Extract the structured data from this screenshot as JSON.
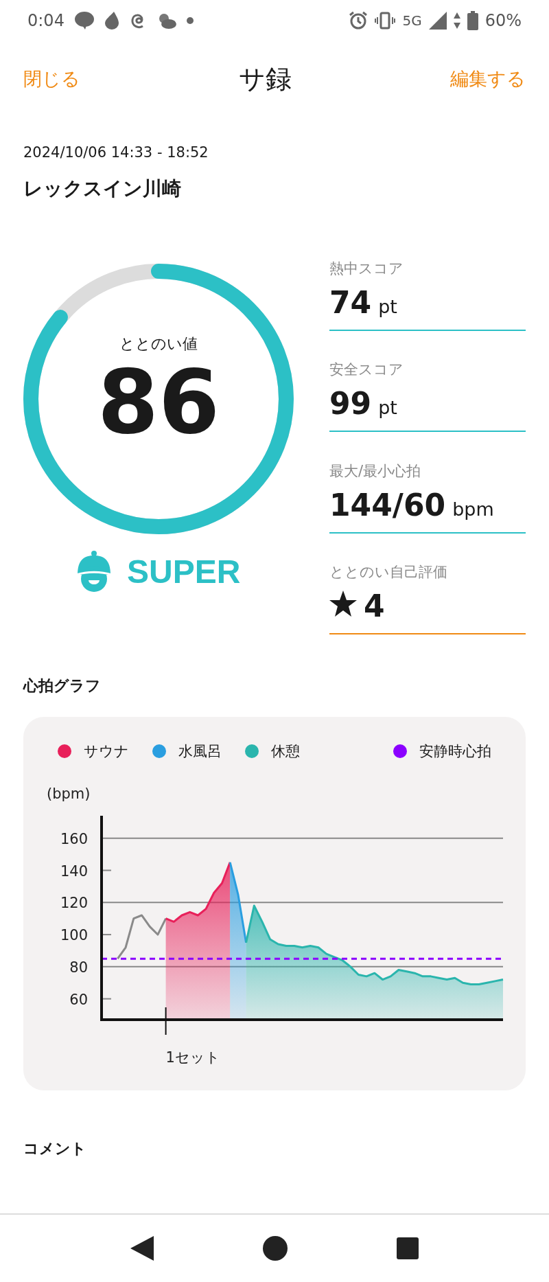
{
  "status_bar": {
    "time": "0:04",
    "network": "5G",
    "battery": "60%"
  },
  "header": {
    "close": "閉じる",
    "title": "サ録",
    "edit": "編集する"
  },
  "session": {
    "datetime": "2024/10/06 14:33 - 18:52",
    "venue": "レックスイン川崎"
  },
  "gauge": {
    "label": "ととのい値",
    "value": "86",
    "rank": "SUPER"
  },
  "stats": [
    {
      "kind": "score",
      "label": "熱中スコア",
      "value": "74",
      "unit": "pt"
    },
    {
      "kind": "score",
      "label": "安全スコア",
      "value": "99",
      "unit": "pt"
    },
    {
      "kind": "score",
      "label": "最大/最小心拍",
      "value": "144/60",
      "unit": "bpm"
    },
    {
      "kind": "rating",
      "label": "ととのい自己評価",
      "value": "4"
    }
  ],
  "heart_rate": {
    "title": "心拍グラフ",
    "chart_data": {
      "type": "line",
      "ylabel": "(bpm)",
      "ylim": [
        47,
        174
      ],
      "yticks": [
        60,
        80,
        100,
        120,
        140,
        160
      ],
      "grid": true,
      "annotations": [
        "1セット"
      ],
      "ref_lines": [
        {
          "axis": "y",
          "value": 85,
          "label": "安静時心拍",
          "color": "#8b00ff"
        }
      ],
      "series": [
        {
          "color": "#8a8a8a",
          "values": [
            null,
            null,
            85,
            92,
            110,
            112,
            105,
            100,
            110,
            null,
            null,
            null,
            null,
            null,
            null,
            null,
            null,
            null,
            null,
            null,
            null,
            null,
            null,
            null,
            null,
            null,
            null,
            null,
            null,
            null,
            null,
            null,
            null,
            null,
            null,
            null,
            null,
            null,
            null,
            null,
            null,
            null,
            null,
            null,
            null,
            null,
            null,
            null,
            null,
            null,
            null
          ]
        },
        {
          "name": "サウナ",
          "color": "#e8205a",
          "values": [
            null,
            null,
            null,
            null,
            null,
            null,
            null,
            null,
            110,
            108,
            112,
            114,
            112,
            116,
            126,
            132,
            145,
            null,
            null,
            null,
            null,
            null,
            null,
            null,
            null,
            null,
            null,
            null,
            null,
            null,
            null,
            null,
            null,
            null,
            null,
            null,
            null,
            null,
            null,
            null,
            null,
            null,
            null,
            null,
            null,
            null,
            null,
            null,
            null,
            null,
            null
          ]
        },
        {
          "name": "水風呂",
          "color": "#2a9ee0",
          "values": [
            null,
            null,
            null,
            null,
            null,
            null,
            null,
            null,
            null,
            null,
            null,
            null,
            null,
            null,
            null,
            null,
            145,
            125,
            95,
            null,
            null,
            null,
            null,
            null,
            null,
            null,
            null,
            null,
            null,
            null,
            null,
            null,
            null,
            null,
            null,
            null,
            null,
            null,
            null,
            null,
            null,
            null,
            null,
            null,
            null,
            null,
            null,
            null,
            null,
            null,
            null
          ]
        },
        {
          "name": "休憩",
          "color": "#2ab5ad",
          "values": [
            null,
            null,
            null,
            null,
            null,
            null,
            null,
            null,
            null,
            null,
            null,
            null,
            null,
            null,
            null,
            null,
            null,
            null,
            95,
            118,
            108,
            97,
            94,
            93,
            93,
            92,
            93,
            92,
            88,
            86,
            84,
            80,
            75,
            74,
            76,
            72,
            74,
            78,
            77,
            76,
            74,
            74,
            73,
            72,
            73,
            70,
            69,
            69,
            70,
            71,
            72
          ]
        }
      ]
    }
  },
  "comment": {
    "title": "コメント"
  }
}
